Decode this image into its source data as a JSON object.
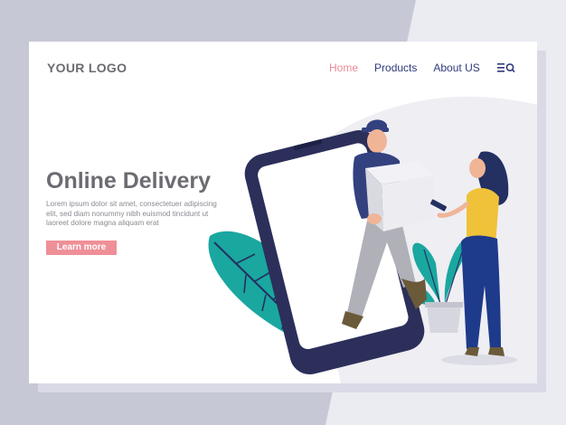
{
  "header": {
    "logo": "YOUR LOGO"
  },
  "nav": {
    "items": [
      {
        "label": "Home",
        "active": true
      },
      {
        "label": "Products",
        "active": false
      },
      {
        "label": "About US",
        "active": false
      }
    ],
    "menu_icon": "menu-search-icon"
  },
  "hero": {
    "title": "Online Delivery",
    "description": "Lorem ipsum dolor sit amet, consectetuer adipiscing elit, sed diam nonummy nibh euismod tincidunt ut laoreet dolore magna aliquam erat",
    "cta_label": "Learn more"
  },
  "colors": {
    "background": "#c7c8d6",
    "page": "#ffffff",
    "accent_pink": "#ef8f98",
    "nav_text": "#2f3a7a",
    "phone": "#2c2f5a",
    "leaf_teal": "#1aa7a0",
    "courier_blue": "#33417f",
    "woman_yellow": "#f0c23a"
  },
  "illustration": {
    "icons": [
      "smartphone-illustration",
      "courier-illustration",
      "package-box-illustration",
      "woman-customer-illustration",
      "leaf-plant-illustration",
      "potted-plant-illustration"
    ]
  }
}
